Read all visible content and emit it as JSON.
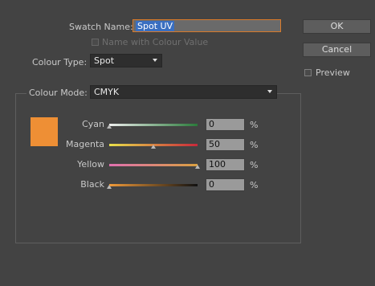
{
  "swatch_name": {
    "label": "Swatch Name:",
    "value": "Spot UV"
  },
  "name_with_colour_value": {
    "label": "Name with Colour Value",
    "checked": false
  },
  "colour_type": {
    "label": "Colour Type:",
    "value": "Spot"
  },
  "colour_mode": {
    "label": "Colour Mode:",
    "value": "CMYK"
  },
  "buttons": {
    "ok": "OK",
    "cancel": "Cancel"
  },
  "preview": {
    "label": "Preview",
    "checked": false
  },
  "swatch_color": "#ee8f35",
  "sliders": [
    {
      "label": "Cyan",
      "value": "0",
      "unit": "%",
      "position": 0.0,
      "gradient": [
        "#eeeeee",
        "#2a7a3a"
      ]
    },
    {
      "label": "Magenta",
      "value": "50",
      "unit": "%",
      "position": 0.5,
      "gradient": [
        "#e8e04a",
        "#c8283a"
      ]
    },
    {
      "label": "Yellow",
      "value": "100",
      "unit": "%",
      "position": 1.0,
      "gradient": [
        "#e070b0",
        "#d9a040"
      ]
    },
    {
      "label": "Black",
      "value": "0",
      "unit": "%",
      "position": 0.0,
      "gradient": [
        "#ef9a3a",
        "#111111"
      ]
    }
  ]
}
